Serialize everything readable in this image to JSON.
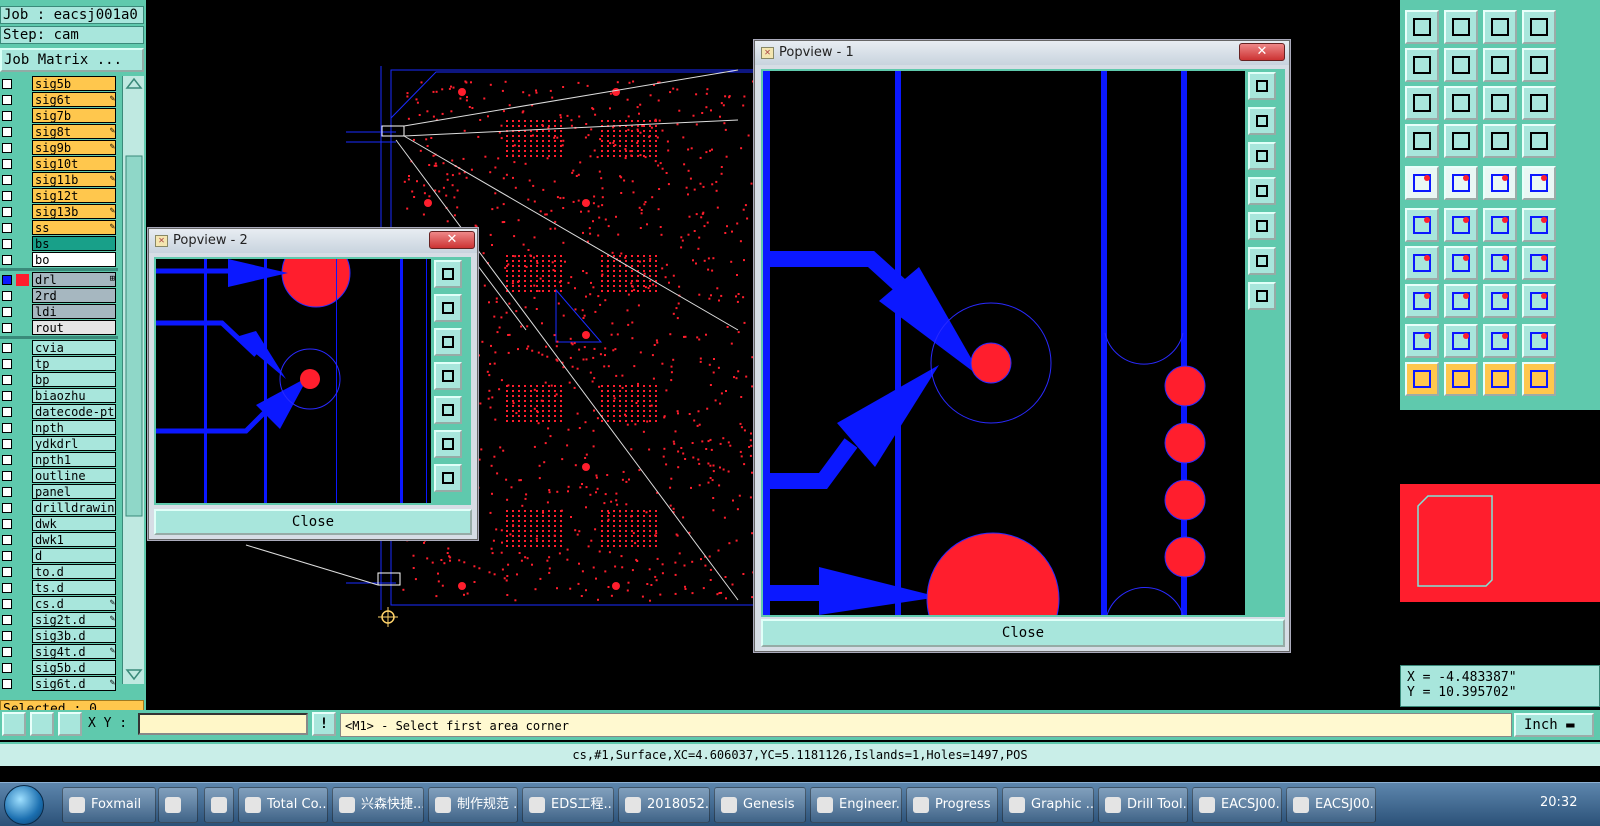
{
  "left_panel": {
    "job": "Job : eacsj001a0",
    "step": "Step: cam",
    "job_matrix": "Job Matrix ...",
    "selected": "Selected : 0",
    "layers": [
      {
        "name": "sig5b",
        "color": "#ffc74d",
        "mark": ""
      },
      {
        "name": "sig6t",
        "color": "#ffc74d",
        "mark": "✎"
      },
      {
        "name": "sig7b",
        "color": "#ffc74d",
        "mark": ""
      },
      {
        "name": "sig8t",
        "color": "#ffc74d",
        "mark": "✎"
      },
      {
        "name": "sig9b",
        "color": "#ffc74d",
        "mark": "✎"
      },
      {
        "name": "sig10t",
        "color": "#ffc74d",
        "mark": ""
      },
      {
        "name": "sig11b",
        "color": "#ffc74d",
        "mark": "✎"
      },
      {
        "name": "sig12t",
        "color": "#ffc74d",
        "mark": ""
      },
      {
        "name": "sig13b",
        "color": "#ffc74d",
        "mark": "✎"
      },
      {
        "name": "ss",
        "color": "#ffc74d",
        "mark": "✎"
      },
      {
        "name": "bs",
        "color": "#18a089",
        "mark": ""
      },
      {
        "name": "bo",
        "color": "#ffffff",
        "mark": ""
      },
      {
        "name": "drl",
        "color": "#a6b7c0",
        "mark": "⊞",
        "active": true
      },
      {
        "name": "2rd",
        "color": "#a6b7c0",
        "mark": ""
      },
      {
        "name": "ldi",
        "color": "#a6b7c0",
        "mark": ""
      },
      {
        "name": "rout",
        "color": "#e5e5e5",
        "mark": ""
      },
      {
        "name": "cvia",
        "color": "#a8e6dc",
        "mark": ""
      },
      {
        "name": "tp",
        "color": "#a8e6dc",
        "mark": ""
      },
      {
        "name": "bp",
        "color": "#a8e6dc",
        "mark": ""
      },
      {
        "name": "biaozhu",
        "color": "#a8e6dc",
        "mark": ""
      },
      {
        "name": "datecode-pte",
        "color": "#a8e6dc",
        "mark": ""
      },
      {
        "name": "npth",
        "color": "#a8e6dc",
        "mark": ""
      },
      {
        "name": "ydkdrl",
        "color": "#a8e6dc",
        "mark": ""
      },
      {
        "name": "npth1",
        "color": "#a8e6dc",
        "mark": ""
      },
      {
        "name": "outline",
        "color": "#a8e6dc",
        "mark": ""
      },
      {
        "name": "panel",
        "color": "#a8e6dc",
        "mark": ""
      },
      {
        "name": "drilldrawing",
        "color": "#a8e6dc",
        "mark": ""
      },
      {
        "name": "dwk",
        "color": "#a8e6dc",
        "mark": ""
      },
      {
        "name": "dwk1",
        "color": "#a8e6dc",
        "mark": ""
      },
      {
        "name": "d",
        "color": "#a8e6dc",
        "mark": ""
      },
      {
        "name": "to.d",
        "color": "#a8e6dc",
        "mark": ""
      },
      {
        "name": "ts.d",
        "color": "#a8e6dc",
        "mark": ""
      },
      {
        "name": "cs.d",
        "color": "#a8e6dc",
        "mark": "✎"
      },
      {
        "name": "sig2t.d",
        "color": "#a8e6dc",
        "mark": "✎"
      },
      {
        "name": "sig3b.d",
        "color": "#a8e6dc",
        "mark": ""
      },
      {
        "name": "sig4t.d",
        "color": "#a8e6dc",
        "mark": "✎"
      },
      {
        "name": "sig5b.d",
        "color": "#a8e6dc",
        "mark": ""
      },
      {
        "name": "sig6t.d",
        "color": "#a8e6dc",
        "mark": "✎"
      }
    ]
  },
  "popview1": {
    "title": "Popview - 1",
    "close": "Close",
    "close_x": "✕"
  },
  "popview2": {
    "title": "Popview - 2",
    "close": "Close",
    "close_x": "✕"
  },
  "coords": {
    "x": "X = -4.483387\"",
    "y": "Y = 10.395702\""
  },
  "command": {
    "xy_label": "X Y :",
    "xy_value": "",
    "prompt": "<M1> - Select first area corner",
    "units": "Inch ▬"
  },
  "status": "cs,#1,Surface,XC=4.606037,YC=5.1181126,Islands=1,Holes=1497,POS",
  "taskbar": {
    "items": [
      "Foxmail",
      "",
      "",
      "Total Co...",
      "兴森快捷...",
      "制作规范 ...",
      "EDS工程...",
      "2018052...",
      "Genesis",
      "Engineer...",
      "Progress",
      "Graphic ...",
      "Drill Tool...",
      "EACSJ00...",
      "EACSJ00..."
    ],
    "clock": "20:32"
  },
  "colors": {
    "panel": "#5fc9ad",
    "yellow_layer": "#ffc74d",
    "pcb_red": "#ff1e2d",
    "trace_blue": "#0b18ff"
  }
}
